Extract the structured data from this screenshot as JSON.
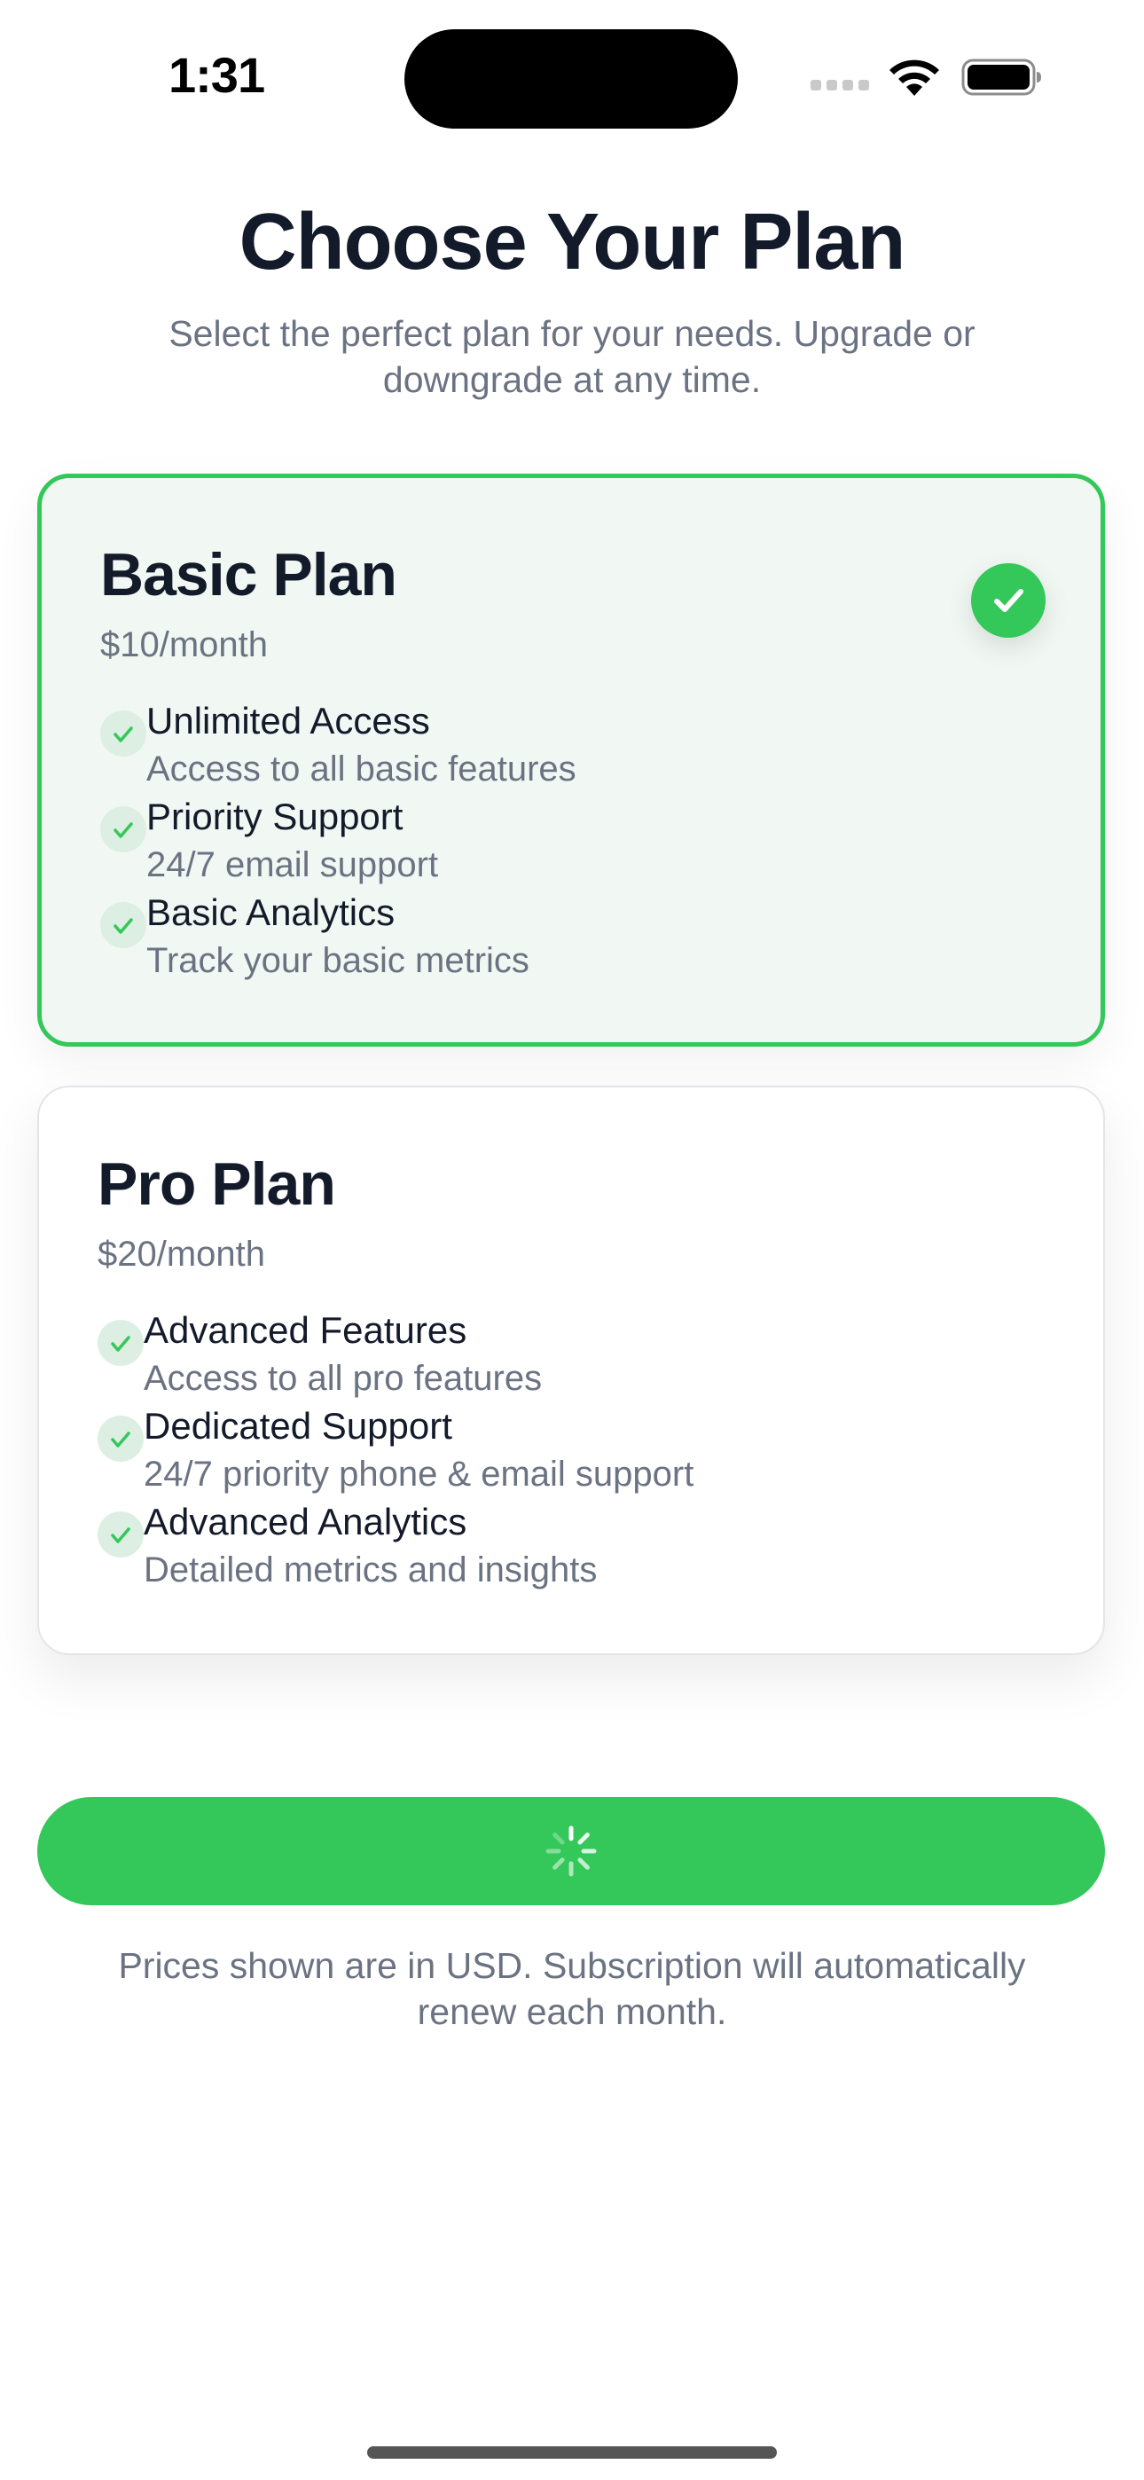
{
  "status_bar": {
    "time": "1:31"
  },
  "header": {
    "title": "Choose Your Plan",
    "subtitle": "Select the perfect plan for your needs. Upgrade or downgrade at any time."
  },
  "plans": [
    {
      "name": "Basic Plan",
      "price": "$10/month",
      "selected": true,
      "features": [
        {
          "title": "Unlimited Access",
          "desc": "Access to all basic features"
        },
        {
          "title": "Priority Support",
          "desc": "24/7 email support"
        },
        {
          "title": "Basic Analytics",
          "desc": "Track your basic metrics"
        }
      ]
    },
    {
      "name": "Pro Plan",
      "price": "$20/month",
      "selected": false,
      "features": [
        {
          "title": "Advanced Features",
          "desc": "Access to all pro features"
        },
        {
          "title": "Dedicated Support",
          "desc": "24/7 priority phone & email support"
        },
        {
          "title": "Advanced Analytics",
          "desc": "Detailed metrics and insights"
        }
      ]
    }
  ],
  "subscribe_button": {
    "state": "loading",
    "icon": "spinner-icon"
  },
  "footer": {
    "note": "Prices shown are in USD. Subscription will automatically renew each month."
  },
  "colors": {
    "accent": "#34c759",
    "selected_card_bg": "#f1f8f3",
    "title_text": "#131a2a",
    "secondary_text": "#6b7383"
  }
}
